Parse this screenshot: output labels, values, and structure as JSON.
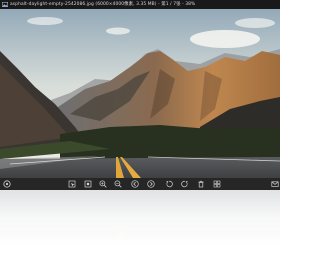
{
  "window": {
    "title": "asphalt-daylight-empty-2542086.jpg (6000×4000像素, 3.35 MB) - 第1 / 7张 - 38%"
  },
  "image": {
    "subject": "mountain road at sunset",
    "colors": {
      "sky_top": "#9fb3c2",
      "sky_bottom": "#eef0ec",
      "mountain_lit": "#b07a4c",
      "mountain_shadow": "#3f3a34",
      "forest": "#2a3226",
      "road": "#4c4e50",
      "center_line": "#e0a63a"
    }
  },
  "toolbar": {
    "icons": [
      "menu-icon",
      "select-icon",
      "fit-window-icon",
      "zoom-in-icon",
      "zoom-out-icon",
      "previous-icon",
      "next-icon",
      "rotate-left-icon",
      "rotate-right-icon",
      "delete-icon",
      "thumbnails-icon",
      "share-icon"
    ]
  },
  "colors": {
    "titlebar_bg": "#191919",
    "toolbar_bg": "#262626",
    "icon": "#d0d0d0"
  }
}
